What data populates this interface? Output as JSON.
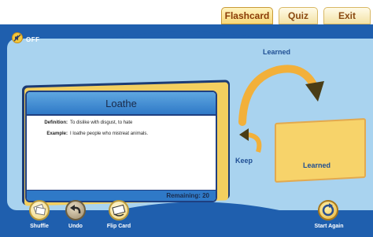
{
  "tabs": [
    {
      "label": "Flashcard",
      "active": true
    },
    {
      "label": "Quiz",
      "active": false
    },
    {
      "label": "Exit",
      "active": false
    }
  ],
  "sound": {
    "state": "OFF",
    "icon": "speaker-off-icon"
  },
  "card": {
    "word": "Loathe",
    "definition_label": "Definition:",
    "definition": "To dislike with disgust, to hate",
    "example_label": "Example:",
    "example": "I loathe people who mistreat animals.",
    "remaining": "Remaining: 20"
  },
  "labels": {
    "learned_arrow": "Learned",
    "keep": "Keep",
    "learned_pile": "Learned"
  },
  "buttons": {
    "shuffle": "Shuffle",
    "undo": "Undo",
    "flip_card": "Flip Card",
    "start_again": "Start Again"
  },
  "colors": {
    "background": "#1f5fae",
    "panel": "#a9d3ef",
    "card_header": "#2f79c7",
    "accent": "#f3cf5f"
  }
}
